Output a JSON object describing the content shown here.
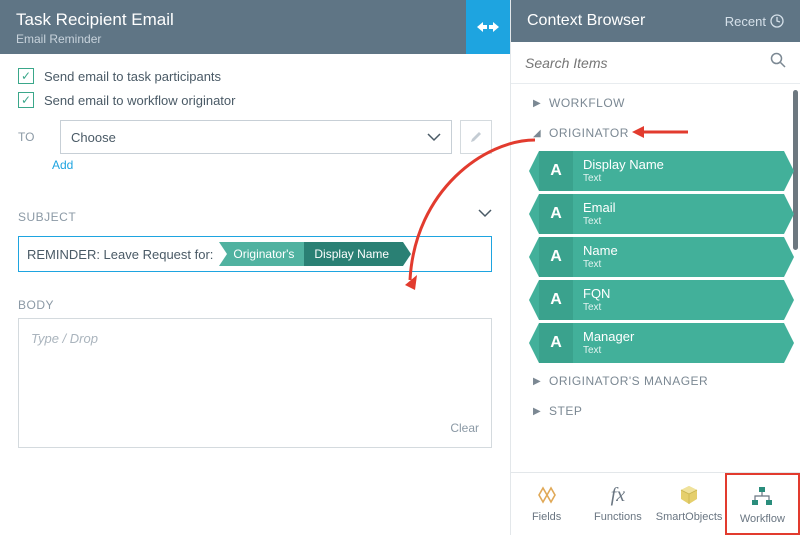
{
  "header": {
    "title": "Task Recipient Email",
    "subtitle": "Email Reminder",
    "context_title": "Context Browser",
    "recent_label": "Recent"
  },
  "checkboxes": {
    "participants": "Send email to task participants",
    "originator": "Send email to workflow originator"
  },
  "to": {
    "label": "TO",
    "placeholder": "Choose",
    "add": "Add"
  },
  "subject": {
    "label": "SUBJECT",
    "prefix": "REMINDER: Leave Request for:",
    "tag1": "Originator's",
    "tag2": "Display Name"
  },
  "body": {
    "label": "BODY",
    "placeholder": "Type / Drop",
    "clear": "Clear"
  },
  "search": {
    "placeholder": "Search Items"
  },
  "tree": {
    "workflow": "WORKFLOW",
    "originator": "ORIGINATOR",
    "orig_manager": "ORIGINATOR'S MANAGER",
    "step": "STEP",
    "fields": [
      {
        "name": "Display Name",
        "type": "Text"
      },
      {
        "name": "Email",
        "type": "Text"
      },
      {
        "name": "Name",
        "type": "Text"
      },
      {
        "name": "FQN",
        "type": "Text"
      },
      {
        "name": "Manager",
        "type": "Text"
      }
    ]
  },
  "tabs": {
    "fields": "Fields",
    "functions": "Functions",
    "smartobjects": "SmartObjects",
    "workflow": "Workflow"
  }
}
